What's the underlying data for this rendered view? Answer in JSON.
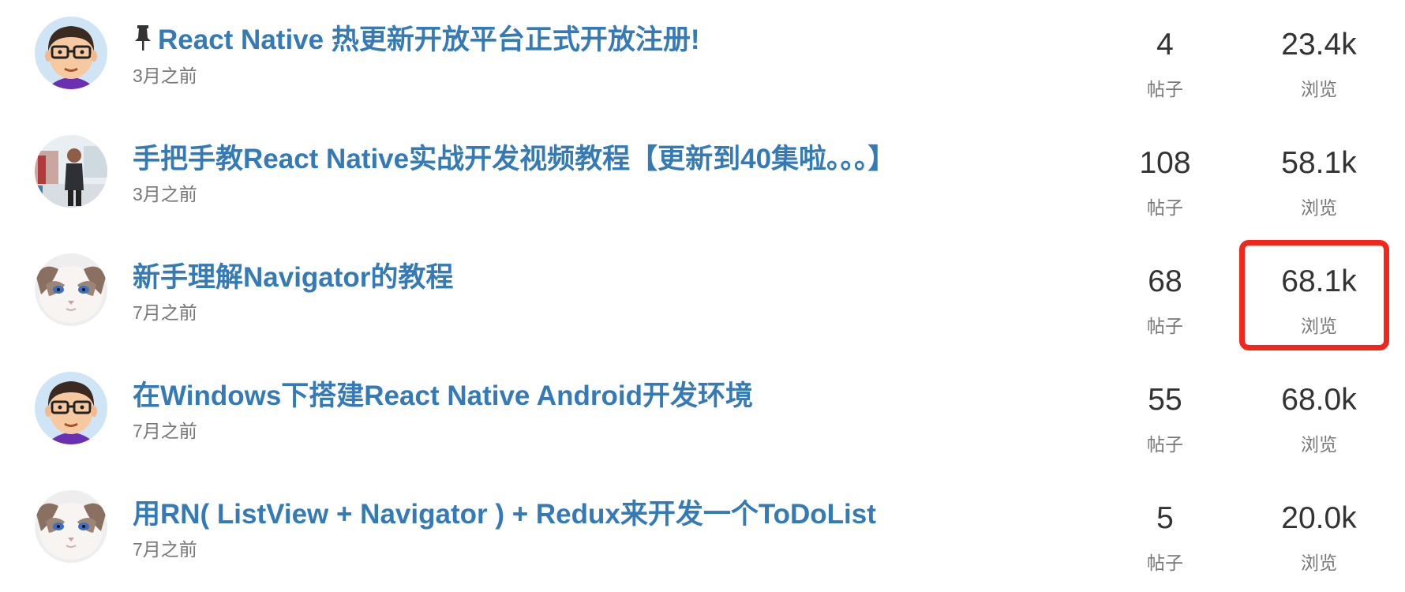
{
  "topics": [
    {
      "title": "React Native 热更新开放平台正式开放注册!",
      "pinned": true,
      "time": "3月之前",
      "posts_count": "4",
      "posts_label": "帖子",
      "views_count": "23.4k",
      "views_label": "浏览",
      "avatar": "cartoon-glasses-avatar"
    },
    {
      "title": "手把手教React Native实战开发视频教程【更新到40集啦。。。】",
      "pinned": false,
      "time": "3月之前",
      "posts_count": "108",
      "posts_label": "帖子",
      "views_count": "58.1k",
      "views_label": "浏览",
      "avatar": "person-photo-avatar"
    },
    {
      "title": "新手理解Navigator的教程",
      "pinned": false,
      "time": "7月之前",
      "posts_count": "68",
      "posts_label": "帖子",
      "views_count": "68.1k",
      "views_label": "浏览",
      "avatar": "cat-photo-avatar",
      "highlighted": "views"
    },
    {
      "title": "在Windows下搭建React Native Android开发环境",
      "pinned": false,
      "time": "7月之前",
      "posts_count": "55",
      "posts_label": "帖子",
      "views_count": "68.0k",
      "views_label": "浏览",
      "avatar": "cartoon-glasses-avatar"
    },
    {
      "title": "用RN( ListView + Navigator ) + Redux来开发一个ToDoList",
      "pinned": false,
      "time": "7月之前",
      "posts_count": "5",
      "posts_label": "帖子",
      "views_count": "20.0k",
      "views_label": "浏览",
      "avatar": "cat-photo-avatar"
    }
  ],
  "colors": {
    "link": "#337ab7",
    "muted": "#777777",
    "stat": "#333333",
    "highlight": "#f2261d"
  },
  "icons": {
    "pin": "pushpin-icon"
  }
}
